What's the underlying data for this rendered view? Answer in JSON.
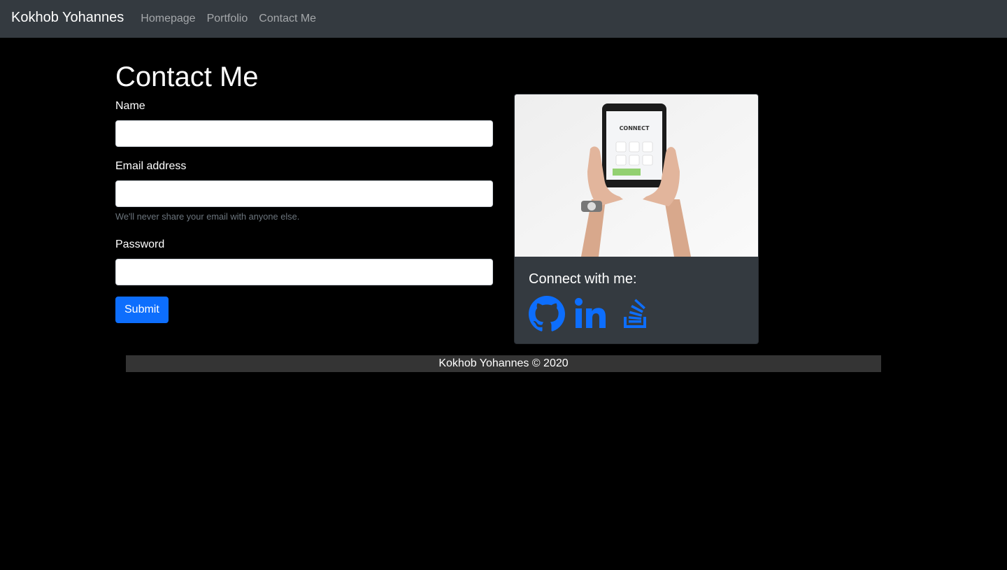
{
  "navbar": {
    "brand": "Kokhob Yohannes",
    "links": [
      "Homepage",
      "Portfolio",
      "Contact Me"
    ]
  },
  "page": {
    "title": "Contact Me"
  },
  "form": {
    "name_label": "Name",
    "name_value": "",
    "email_label": "Email address",
    "email_value": "",
    "email_help": "We'll never share your email with anyone else.",
    "password_label": "Password",
    "password_value": "",
    "submit_label": "Submit"
  },
  "card": {
    "image_screen_text": "CONNECT",
    "title": "Connect with me:",
    "socials": [
      "github-icon",
      "linkedin-icon",
      "stackoverflow-icon"
    ]
  },
  "footer": {
    "text": "Kokhob Yohannes © 2020"
  },
  "colors": {
    "navbar": "#343a40",
    "background": "#000000",
    "primary": "#0d6efd",
    "footer": "#343434"
  }
}
